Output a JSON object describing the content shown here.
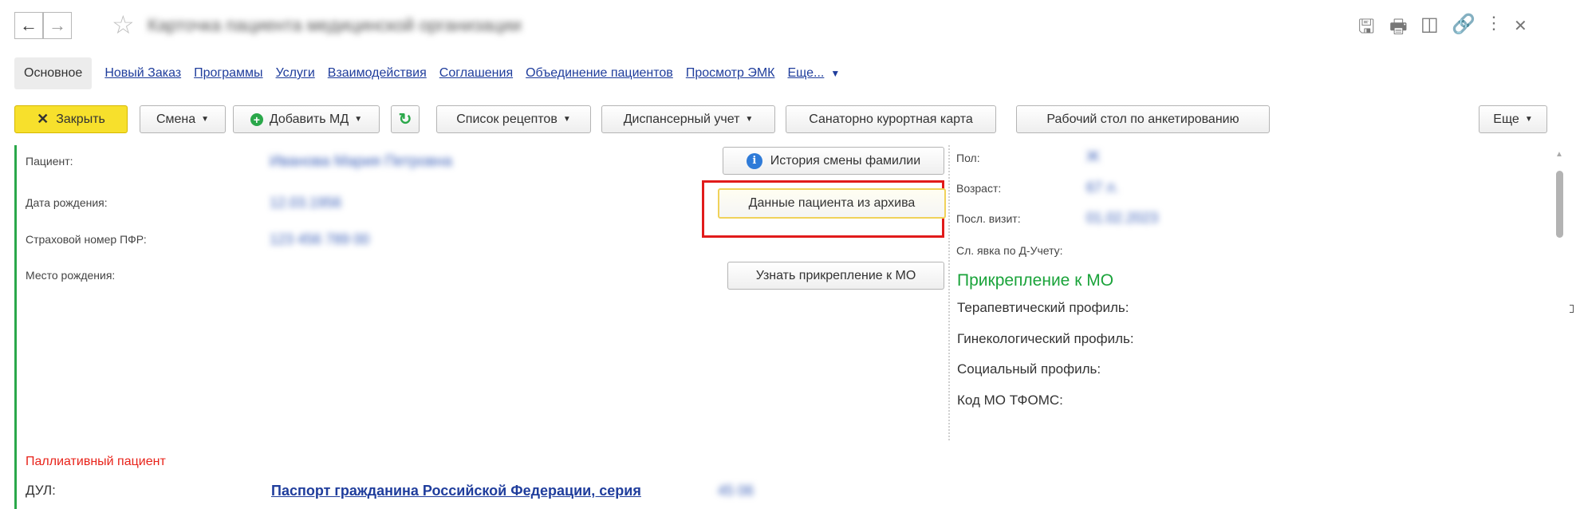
{
  "window": {
    "back_icon": "arrow-left-icon",
    "forward_icon": "arrow-right-icon",
    "title": "Карточка пациента медицинской организации",
    "actions": [
      "save-icon",
      "print-icon",
      "preview-icon",
      "link-icon",
      "more-vertical-icon",
      "close-icon"
    ]
  },
  "tabs": {
    "active": "Основное",
    "links": [
      "Новый Заказ",
      "Программы",
      "Услуги",
      "Взаимодействия",
      "Соглашения",
      "Объединение пациентов",
      "Просмотр ЭМК",
      "Еще..."
    ]
  },
  "toolbar": {
    "close": "Закрыть",
    "shift": "Смена",
    "add_md": "Добавить МД",
    "recipes": "Список рецептов",
    "dispensary": "Диспансерный учет",
    "sanatorium": "Санаторно курортная карта",
    "survey": "Рабочий стол по анкетированию",
    "more": "Еще"
  },
  "patient": {
    "patient_label": "Пациент:",
    "patient_value": "Иванова Мария Петровна",
    "birth_label": "Дата рождения:",
    "birth_value": "12.03.1956",
    "snils_label": "Страховой номер ПФР:",
    "snils_value": "123 456 789 00",
    "birthplace_label": "Место рождения:",
    "surname_history_btn": "История смены фамилии",
    "archive_btn": "Данные пациента из архива",
    "attach_btn": "Узнать прикрепление к МО",
    "palliative": "Паллиативный пациент",
    "dul_label": "ДУЛ:",
    "dul_link": "Паспорт гражданина Российской Федерации, серия",
    "dul_series": "45 06"
  },
  "info": {
    "sex_label": "Пол:",
    "sex_value": "Ж",
    "age_label": "Возраст:",
    "age_value": "67 л.",
    "last_visit_label": "Посл. визит:",
    "last_visit_value": "01.02.2023",
    "next_label": "Сл. явка по Д-Учету:",
    "attach_header": "Прикрепление к МО",
    "therapy": "Терапевтический профиль:",
    "gyn": "Гинекологический профиль:",
    "social": "Социальный профиль:",
    "code": "Код МО ТФОМС:"
  },
  "colors": {
    "accent_yellow": "#f7e02c",
    "link_blue": "#1f3d9c",
    "green_header": "#1aa33a",
    "red_text": "#e8231a",
    "highlight_red": "#e11b1b",
    "left_bar_green": "#2aa84a"
  }
}
